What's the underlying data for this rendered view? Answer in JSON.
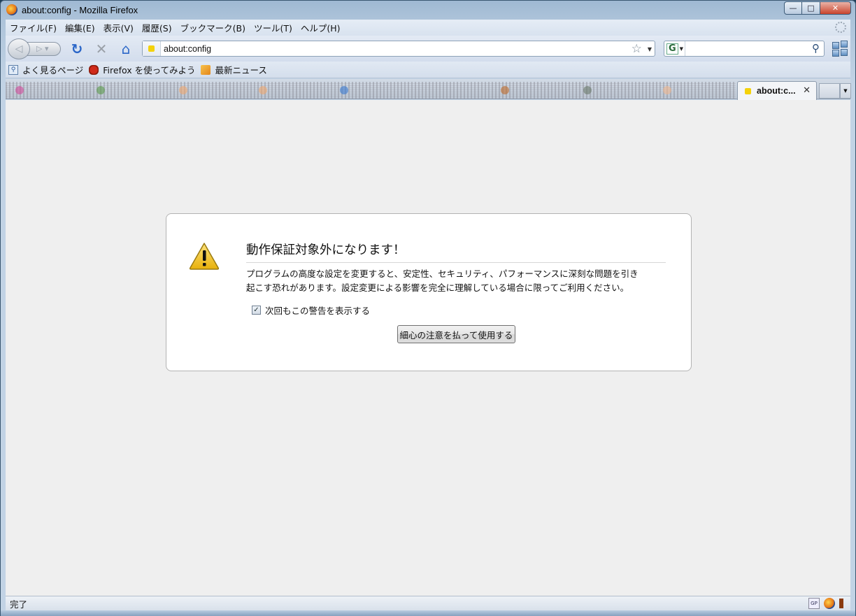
{
  "window": {
    "title": "about:config - Mozilla Firefox",
    "controls": {
      "minimize": "—",
      "maximize": "□",
      "close": "✕"
    }
  },
  "menubar": {
    "items": [
      "ファイル(F)",
      "編集(E)",
      "表示(V)",
      "履歴(S)",
      "ブックマーク(B)",
      "ツール(T)",
      "ヘルプ(H)"
    ]
  },
  "navbar": {
    "url": "about:config",
    "back_icon": "back-arrow-icon",
    "forward_icon": "forward-arrow-icon",
    "search_value": "",
    "search_engine": "G"
  },
  "bookmarks": {
    "items": [
      "よく見るページ",
      "Firefox を使ってみよう",
      "最新ニュース"
    ]
  },
  "tabs": {
    "active_label": "about:c..."
  },
  "warning": {
    "title": "動作保証対象外になります！",
    "message_line1": "プログラムの高度な設定を変更すると、安定性、セキュリティ、パフォーマンスに深刻な問題を引き",
    "message_line2": "起こす恐れがあります。設定変更による影響を完全に理解している場合に限ってご利用ください。",
    "checkbox_label": "次回もこの警告を表示する",
    "checkbox_checked": true,
    "button_label": "細心の注意を払って使用する"
  },
  "statusbar": {
    "text": "完了"
  },
  "colors": {
    "content_background": "#efefef",
    "warning_icon_yellow": "#f4c613",
    "accent_blue": "#2a66c8"
  }
}
